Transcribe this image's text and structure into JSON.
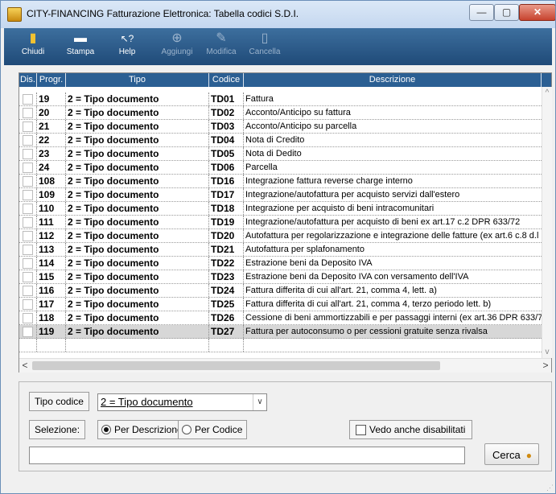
{
  "window": {
    "title": "CITY-FINANCING  Fatturazione Elettronica: Tabella codici S.D.I."
  },
  "title_buttons": {
    "minimize": "—",
    "maximize": "▢",
    "close": "✕"
  },
  "toolbar": [
    {
      "label": "Chiudi",
      "icon": "exit-door-icon",
      "glyph": "▮",
      "disabled": false
    },
    {
      "label": "Stampa",
      "icon": "printer-icon",
      "glyph": "▬",
      "disabled": false
    },
    {
      "label": "Help",
      "icon": "help-pointer-icon",
      "glyph": "↖?",
      "disabled": false
    },
    {
      "label": "Aggiungi",
      "icon": "add-icon",
      "glyph": "⊕",
      "disabled": true
    },
    {
      "label": "Modifica",
      "icon": "edit-folder-icon",
      "glyph": "✎",
      "disabled": true
    },
    {
      "label": "Cancella",
      "icon": "trash-icon",
      "glyph": "▯",
      "disabled": true
    }
  ],
  "grid": {
    "headers": [
      "Dis.",
      "Progr.",
      "Tipo",
      "Codice",
      "Descrizione"
    ],
    "rows": [
      {
        "progr": "19",
        "tipo": "2 = Tipo documento",
        "codice": "TD01",
        "descrizione": "Fattura"
      },
      {
        "progr": "20",
        "tipo": "2 = Tipo documento",
        "codice": "TD02",
        "descrizione": "Acconto/Anticipo su fattura"
      },
      {
        "progr": "21",
        "tipo": "2 = Tipo documento",
        "codice": "TD03",
        "descrizione": "Acconto/Anticipo su parcella"
      },
      {
        "progr": "22",
        "tipo": "2 = Tipo documento",
        "codice": "TD04",
        "descrizione": "Nota di Credito"
      },
      {
        "progr": "23",
        "tipo": "2 = Tipo documento",
        "codice": "TD05",
        "descrizione": "Nota di Dedito"
      },
      {
        "progr": "24",
        "tipo": "2 = Tipo documento",
        "codice": "TD06",
        "descrizione": "Parcella"
      },
      {
        "progr": "108",
        "tipo": "2 = Tipo documento",
        "codice": "TD16",
        "descrizione": "Integrazione fattura reverse charge interno"
      },
      {
        "progr": "109",
        "tipo": "2 = Tipo documento",
        "codice": "TD17",
        "descrizione": "Integrazione/autofattura per acquisto servizi dall'estero"
      },
      {
        "progr": "110",
        "tipo": "2 = Tipo documento",
        "codice": "TD18",
        "descrizione": "Integrazione per acquisto di beni intracomunitari"
      },
      {
        "progr": "111",
        "tipo": "2 = Tipo documento",
        "codice": "TD19",
        "descrizione": "Integrazione/autofattura per acquisto di beni ex art.17 c.2 DPR 633/72"
      },
      {
        "progr": "112",
        "tipo": "2 = Tipo documento",
        "codice": "TD20",
        "descrizione": "Autofattura per regolarizzazione e integrazione delle fatture (ex art.6 c.8 d.l"
      },
      {
        "progr": "113",
        "tipo": "2 = Tipo documento",
        "codice": "TD21",
        "descrizione": "Autofattura per splafonamento"
      },
      {
        "progr": "114",
        "tipo": "2 = Tipo documento",
        "codice": "TD22",
        "descrizione": "Estrazione beni da Deposito IVA"
      },
      {
        "progr": "115",
        "tipo": "2 = Tipo documento",
        "codice": "TD23",
        "descrizione": "Estrazione beni da Deposito IVA con versamento dell'IVA"
      },
      {
        "progr": "116",
        "tipo": "2 = Tipo documento",
        "codice": "TD24",
        "descrizione": "Fattura differita di cui all'art. 21, comma 4, lett. a)"
      },
      {
        "progr": "117",
        "tipo": "2 = Tipo documento",
        "codice": "TD25",
        "descrizione": "Fattura differita di cui all'art. 21, comma 4, terzo periodo lett. b)"
      },
      {
        "progr": "118",
        "tipo": "2 = Tipo documento",
        "codice": "TD26",
        "descrizione": "Cessione di beni ammortizzabili e per passaggi interni (ex art.36 DPR 633/7"
      },
      {
        "progr": "119",
        "tipo": "2 = Tipo documento",
        "codice": "TD27",
        "descrizione": "Fattura per autoconsumo o per cessioni gratuite senza rivalsa",
        "selected": true
      },
      {
        "progr": "",
        "tipo": "",
        "codice": "",
        "descrizione": "",
        "empty": true
      }
    ]
  },
  "filters": {
    "tipo_codice_label": "Tipo codice",
    "tipo_codice_value": "2 = Tipo documento",
    "selezione_label": "Selezione:",
    "per_descrizione": "Per Descrizione",
    "per_codice": "Per Codice",
    "vedo_disabilitati": "Vedo anche disabilitati",
    "cerca": "Cerca",
    "search_value": ""
  },
  "scroll": {
    "up": "^",
    "down": "v",
    "left": "<",
    "right": ">"
  }
}
